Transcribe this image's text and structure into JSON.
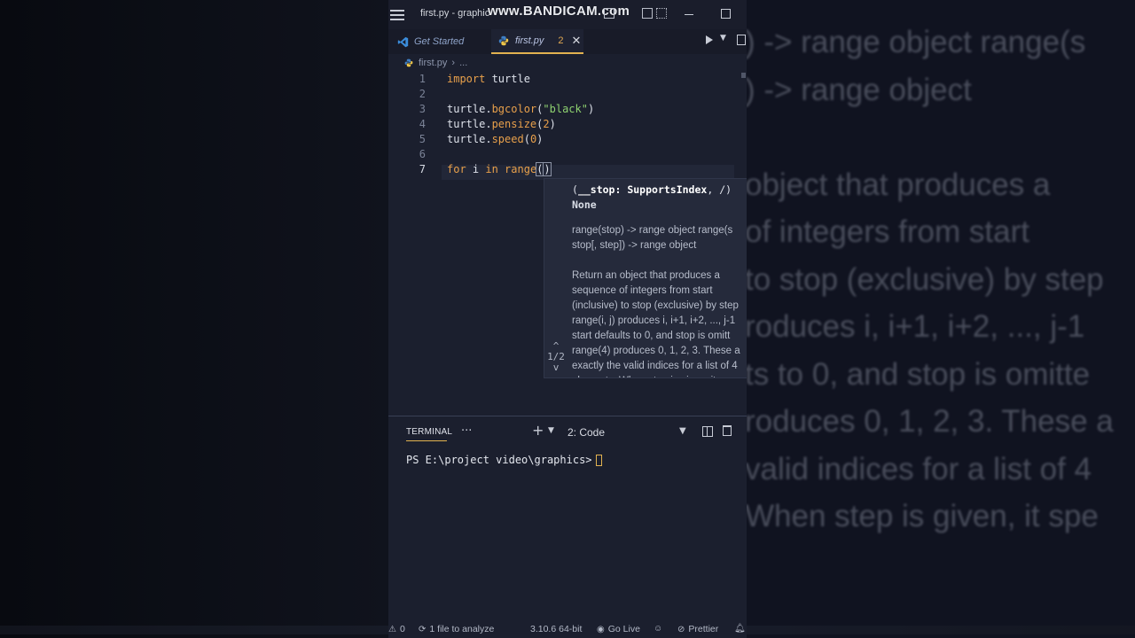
{
  "window": {
    "title": "first.py - graphic",
    "watermark": "www.BANDICAM.com"
  },
  "tabs": [
    {
      "label": "Get Started"
    },
    {
      "label": "first.py",
      "problems": "2",
      "close": "✕"
    }
  ],
  "breadcrumb": {
    "file": "first.py",
    "sep": "›",
    "rest": "..."
  },
  "editor": {
    "lines": [
      {
        "n": "1",
        "tokens": [
          {
            "t": "import",
            "c": "kw"
          },
          {
            "t": " turtle",
            "c": "id"
          }
        ]
      },
      {
        "n": "2",
        "tokens": []
      },
      {
        "n": "3",
        "tokens": [
          {
            "t": "turtle.",
            "c": "id"
          },
          {
            "t": "bgcolor",
            "c": "fn"
          },
          {
            "t": "(",
            "c": "id"
          },
          {
            "t": "\"black\"",
            "c": "str"
          },
          {
            "t": ")",
            "c": "id"
          }
        ]
      },
      {
        "n": "4",
        "tokens": [
          {
            "t": "turtle.",
            "c": "id"
          },
          {
            "t": "pensize",
            "c": "fn"
          },
          {
            "t": "(",
            "c": "id"
          },
          {
            "t": "2",
            "c": "num"
          },
          {
            "t": ")",
            "c": "id"
          }
        ]
      },
      {
        "n": "5",
        "tokens": [
          {
            "t": "turtle.",
            "c": "id"
          },
          {
            "t": "speed",
            "c": "fn"
          },
          {
            "t": "(",
            "c": "id"
          },
          {
            "t": "0",
            "c": "num"
          },
          {
            "t": ")",
            "c": "id"
          }
        ]
      },
      {
        "n": "6",
        "tokens": []
      },
      {
        "n": "7",
        "tokens": [
          {
            "t": "for",
            "c": "kw"
          },
          {
            "t": " i ",
            "c": "id"
          },
          {
            "t": "in",
            "c": "kw"
          },
          {
            "t": " range",
            "c": "fn"
          }
        ]
      }
    ],
    "current_line": 7
  },
  "signature_help": {
    "signature_open": "(",
    "signature_param": "__stop: SupportsIndex",
    "signature_close": ", /)",
    "returns": "None",
    "doc_lines": [
      "range(stop) -> range object range(s",
      "stop[, step]) -> range object",
      "",
      "Return an object that produces a",
      "sequence of integers from start",
      "(inclusive) to stop (exclusive) by step",
      "range(i, j) produces i, i+1, i+2, ..., j-1",
      "start defaults to 0, and stop is omitt",
      "range(4) produces 0, 1, 2, 3. These a",
      "exactly the valid indices for a list of 4",
      "elements. When step is given, it spe"
    ],
    "overload_up": "^",
    "overload_counter": "1/2",
    "overload_down": "v"
  },
  "terminal": {
    "tab_label": "TERMINAL",
    "more": "···",
    "add": "+",
    "instance": "2: Code",
    "prompt": "PS E:\\project video\\graphics>"
  },
  "statusbar": {
    "warnings": "0",
    "analysis": "1 file to analyze",
    "python": "3.10.6 64-bit",
    "golive": "Go Live",
    "prettier": "Prettier"
  },
  "background_blur": [
    ") -> range object range(s",
    ") -> range object",
    "",
    "object that produces a",
    "of integers from start",
    "to stop (exclusive) by step",
    "roduces i, i+1, i+2, ..., j-1",
    "ts to 0, and stop is omitte",
    "roduces 0, 1, 2, 3. These a",
    "valid indices for a list of 4",
    "When step is given, it spe"
  ],
  "colors": {
    "accent": "#e2b250",
    "keyword": "#e8a04b",
    "string": "#8ed170",
    "editor_bg": "#1b1f2e"
  }
}
